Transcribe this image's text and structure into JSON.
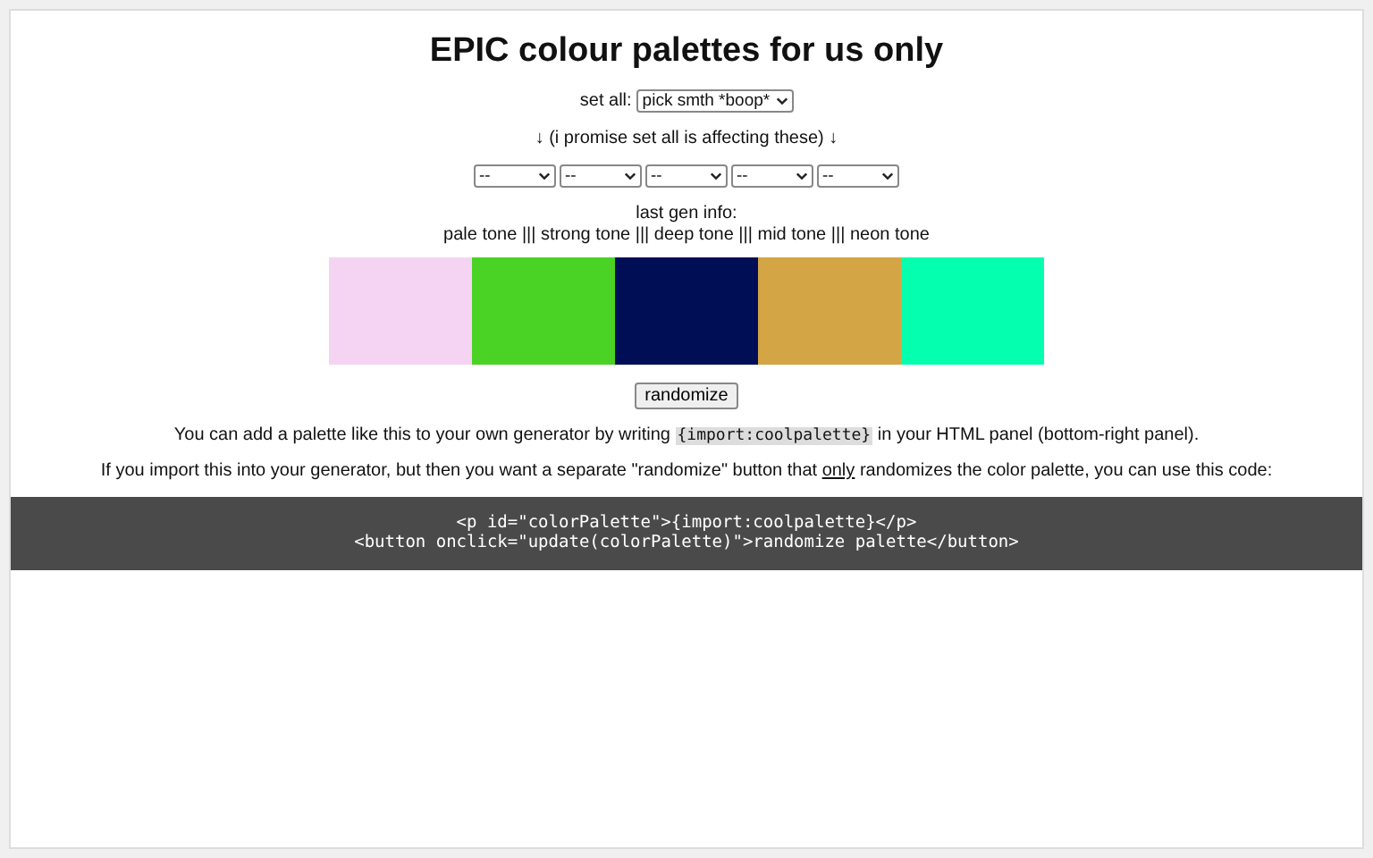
{
  "title": "EPIC colour palettes for us only",
  "set_all": {
    "label": "set all:",
    "value": "pick smth *boop*"
  },
  "note": "↓ (i promise set all is affecting these) ↓",
  "selects": [
    {
      "value": "--"
    },
    {
      "value": "--"
    },
    {
      "value": "--"
    },
    {
      "value": "--"
    },
    {
      "value": "--"
    }
  ],
  "last_gen": {
    "heading": "last gen info:",
    "info": "pale tone ||| strong tone ||| deep tone ||| mid tone ||| neon tone"
  },
  "swatches": [
    {
      "color": "#f5d3f3"
    },
    {
      "color": "#4ad224"
    },
    {
      "color": "#000f55"
    },
    {
      "color": "#d4a544"
    },
    {
      "color": "#04ffae"
    }
  ],
  "randomize_button": "randomize",
  "paragraphs": [
    [
      {
        "kind": "text",
        "text": "You can add a palette like this to your own generator by writing "
      },
      {
        "kind": "code",
        "text": "{import:coolpalette}"
      },
      {
        "kind": "text",
        "text": " in your HTML panel (bottom-right panel)."
      }
    ],
    [
      {
        "kind": "text",
        "text": "If you import this into your generator, but then you want a separate \"randomize\" button that "
      },
      {
        "kind": "underline",
        "text": "only"
      },
      {
        "kind": "text",
        "text": " randomizes the color palette, you can use this code:"
      }
    ]
  ],
  "code_block": [
    "<p id=\"colorPalette\">{import:coolpalette}</p>",
    "<button onclick=\"update(colorPalette)\">randomize palette</button>"
  ]
}
